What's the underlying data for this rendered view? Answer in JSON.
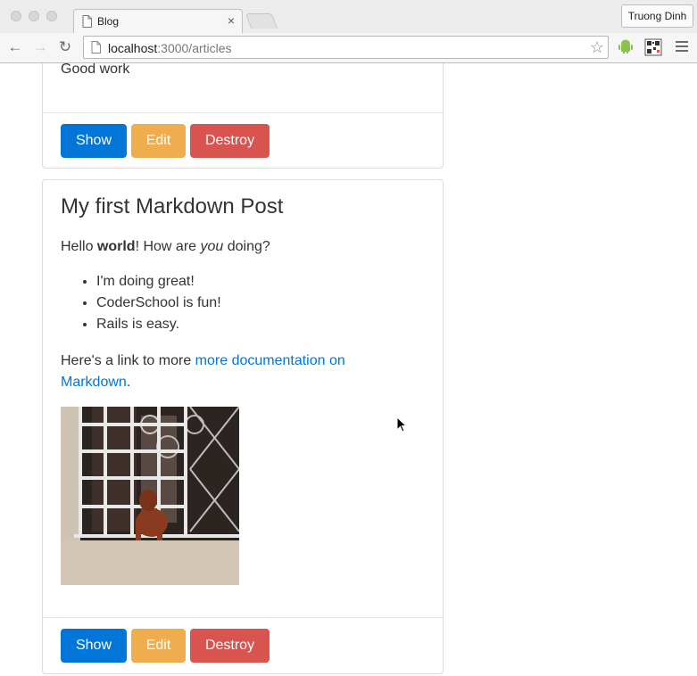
{
  "browser": {
    "tab_title": "Blog",
    "tab_close": "×",
    "profile_name": "Truong Dinh",
    "url_host": "localhost",
    "url_path": ":3000/articles",
    "back_icon": "←",
    "forward_icon": "→",
    "reload_icon": "↻",
    "star_icon": "☆"
  },
  "articles": [
    {
      "body_text": "Good work",
      "buttons": {
        "show": "Show",
        "edit": "Edit",
        "destroy": "Destroy"
      }
    },
    {
      "title": "My first Markdown Post",
      "intro": {
        "pre": "Hello ",
        "bold": "world",
        "mid": "! How are ",
        "italic": "you",
        "post": " doing?"
      },
      "list": [
        "I'm doing great!",
        "CoderSchool is fun!",
        "Rails is easy."
      ],
      "link_para": {
        "pre": "Here's a link to more ",
        "link_line1": "more documentation on",
        "link_line2": "Markdown",
        "post": "."
      },
      "buttons": {
        "show": "Show",
        "edit": "Edit",
        "destroy": "Destroy"
      }
    }
  ],
  "colors": {
    "primary": "#0275d8",
    "warning": "#f0ad4e",
    "danger": "#d9534f"
  }
}
